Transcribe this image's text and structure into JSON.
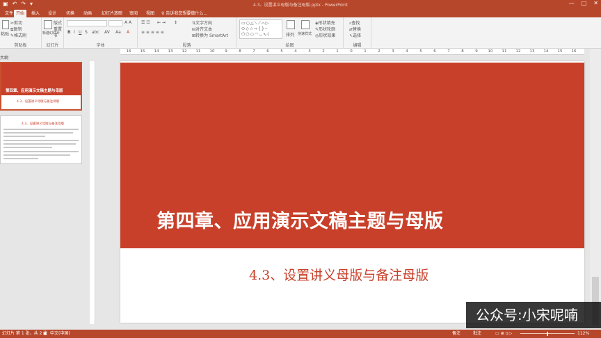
{
  "window": {
    "title": "4.3、设置讲义母版与备注母版.pptx - PowerPoint",
    "controls": [
      "—",
      "□",
      "✕"
    ]
  },
  "tabs": [
    {
      "label": "文件"
    },
    {
      "label": "开始"
    },
    {
      "label": "插入"
    },
    {
      "label": "设计"
    },
    {
      "label": "切换"
    },
    {
      "label": "动画"
    },
    {
      "label": "幻灯片放映"
    },
    {
      "label": "审阅"
    },
    {
      "label": "视图"
    }
  ],
  "tell_me": "告诉我您想要做什么...",
  "ribbon": {
    "clipboard": {
      "label": "剪贴板",
      "paste": "粘贴",
      "cut": "剪切",
      "copy": "复制",
      "format_painter": "格式刷"
    },
    "slides": {
      "label": "幻灯片",
      "new_slide": "新建幻灯片",
      "layout": "版式",
      "reset": "重置",
      "section": "节"
    },
    "font": {
      "label": "字体"
    },
    "paragraph": {
      "label": "段落",
      "text_direction": "文字方向",
      "align_text": "对齐文本",
      "smartart": "转换为 SmartArt"
    },
    "drawing": {
      "label": "绘图",
      "arrange": "排列",
      "quick_styles": "快速样式",
      "shape_fill": "形状填充",
      "shape_outline": "形状轮廓",
      "shape_effects": "形状效果"
    },
    "editing": {
      "label": "编辑",
      "find": "查找",
      "replace": "替换",
      "select": "选择"
    }
  },
  "ruler_ticks": [
    "16",
    "15",
    "14",
    "13",
    "12",
    "11",
    "10",
    "9",
    "8",
    "7",
    "6",
    "5",
    "4",
    "3",
    "2",
    "1",
    "0",
    "1",
    "2",
    "3",
    "4",
    "5",
    "6",
    "7",
    "8",
    "9",
    "10",
    "11",
    "12",
    "13",
    "14",
    "15",
    "16"
  ],
  "thumbnails": {
    "label": "大纲",
    "slide1": {
      "title": "第四章、应用演示文稿主题与母版",
      "subtitle": "4.3、设置讲义母版与备注母版"
    },
    "slide2": {
      "heading": "4.3、设置讲义母版与备注母版"
    }
  },
  "slide": {
    "title": "第四章、应用演示文稿主题与母版",
    "subtitle": "4.3、设置讲义母版与备注母版",
    "accent": "#c8402a"
  },
  "status": {
    "slide_count": "幻灯片 第 1 张，共 2 张",
    "language": "中文(中国)",
    "notes": "备注",
    "comments": "批注",
    "zoom": "112%"
  },
  "watermark": "公众号:小宋呢喃"
}
